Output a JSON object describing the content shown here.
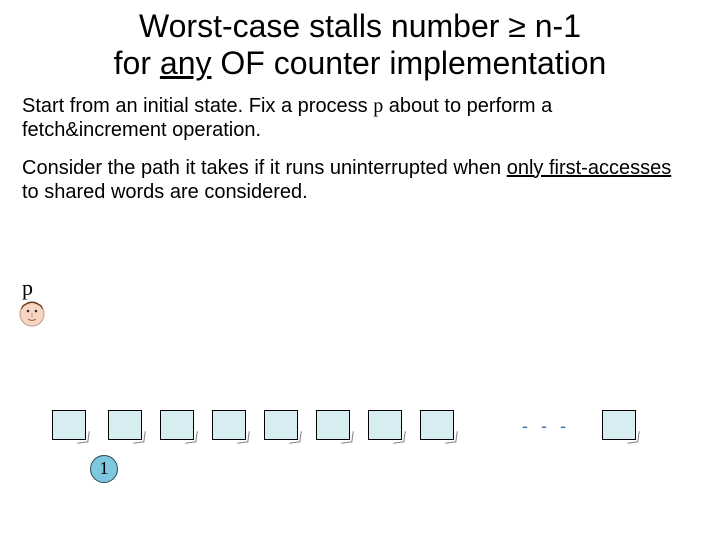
{
  "title": {
    "part1": "Worst-case stalls number ",
    "geq": "≥",
    "part2": "  n-1",
    "line2a": "for ",
    "line2_underlined": "any",
    "line2b": " OF counter implementation"
  },
  "para1": {
    "a": "Start from an initial state. Fix a process ",
    "p": "p",
    "b": " about to perform  a fetch&increment operation."
  },
  "para2": {
    "a": "Consider the path it takes if it runs uninterrupted when ",
    "u": "only  first-accesses",
    "b": " to shared words are considered."
  },
  "process_label": "p",
  "dots": "- - -",
  "counter_value": "1",
  "boxes": {
    "count_before_dots": 8,
    "count_after_dots": 1
  }
}
